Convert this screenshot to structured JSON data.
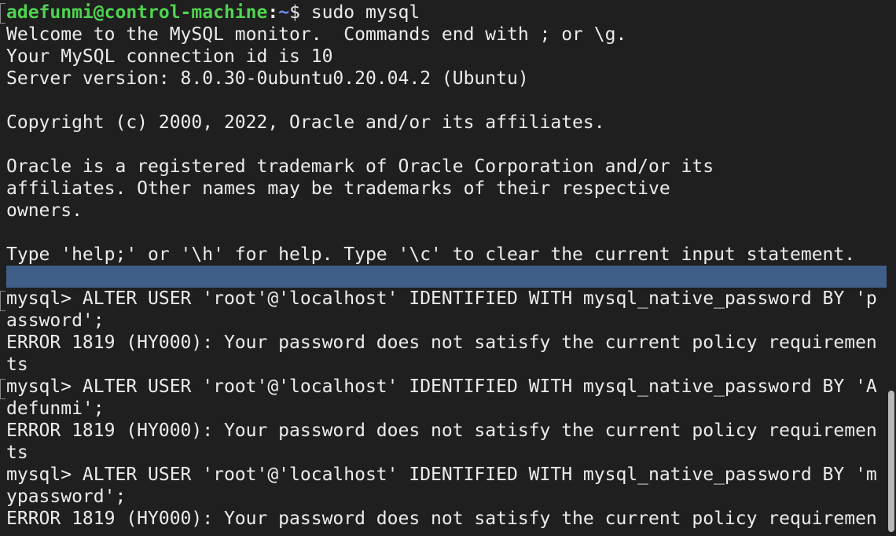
{
  "terminal": {
    "prompt": {
      "user_host": "adefunmi@control-machine",
      "separator": ":",
      "path": "~",
      "symbol": "$ ",
      "command": "sudo mysql"
    },
    "lines": [
      "Welcome to the MySQL monitor.  Commands end with ; or \\g.",
      "Your MySQL connection id is 10",
      "Server version: 8.0.30-0ubuntu0.20.04.2 (Ubuntu)",
      "",
      "Copyright (c) 2000, 2022, Oracle and/or its affiliates.",
      "",
      "Oracle is a registered trademark of Oracle Corporation and/or its",
      "affiliates. Other names may be trademarks of their respective",
      "owners.",
      "",
      "Type 'help;' or '\\h' for help. Type '\\c' to clear the current input statement.",
      "",
      "mysql> ALTER USER 'root'@'localhost' IDENTIFIED WITH mysql_native_password BY 'p",
      "assword';",
      "ERROR 1819 (HY000): Your password does not satisfy the current policy requiremen",
      "ts",
      "mysql> ALTER USER 'root'@'localhost' IDENTIFIED WITH mysql_native_password BY 'A",
      "defunmi';",
      "ERROR 1819 (HY000): Your password does not satisfy the current policy requiremen",
      "ts",
      "mysql> ALTER USER 'root'@'localhost' IDENTIFIED WITH mysql_native_password BY 'm",
      "ypassword';",
      "ERROR 1819 (HY000): Your password does not satisfy the current policy requiremen"
    ],
    "colors": {
      "background": "#1f1f1f",
      "text": "#ececec",
      "user_host": "#4fd44f",
      "path": "#6b8cff",
      "selection": "#3f5f88"
    }
  }
}
